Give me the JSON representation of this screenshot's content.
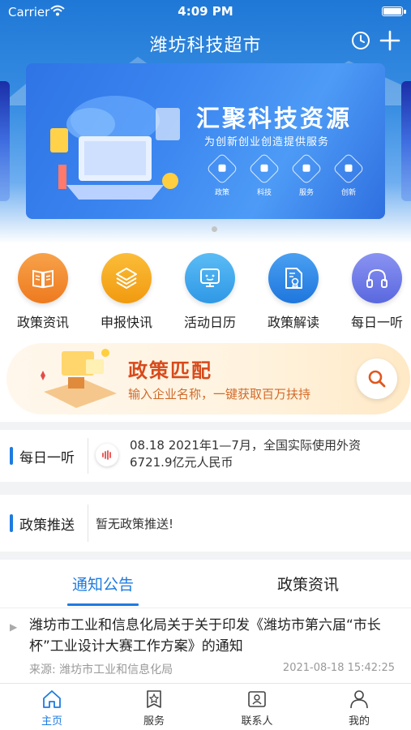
{
  "status_bar": {
    "carrier": "Carrier",
    "time": "4:09 PM"
  },
  "header": {
    "title": "潍坊科技超市"
  },
  "banner": {
    "heading": "汇聚科技资源",
    "subheading": "为创新创业创造提供服务",
    "tags": [
      "政策",
      "科技",
      "服务",
      "创新"
    ]
  },
  "quick_entries": [
    {
      "label": "政策资讯",
      "icon": "book-icon",
      "color": "#f08a2c"
    },
    {
      "label": "申报快讯",
      "icon": "layers-icon",
      "color": "#f4a21d"
    },
    {
      "label": "活动日历",
      "icon": "calendar-screen-icon",
      "color": "#3aa7ee"
    },
    {
      "label": "政策解读",
      "icon": "document-award-icon",
      "color": "#2d86e6"
    },
    {
      "label": "每日一听",
      "icon": "headphones-icon",
      "color": "#6678e8"
    }
  ],
  "policy_match": {
    "title": "政策匹配",
    "description": "输入企业名称，一键获取百万扶持"
  },
  "daily_listen": {
    "label": "每日一听",
    "text": "08.18 2021年1—7月，全国实际使用外资6721.9亿元人民币"
  },
  "policy_push": {
    "label": "政策推送",
    "text": "暂无政策推送!"
  },
  "tabs": [
    {
      "label": "通知公告",
      "active": true
    },
    {
      "label": "政策资讯",
      "active": false
    }
  ],
  "notices": [
    {
      "title": "潍坊市工业和信息化局关于关于印发《潍坊市第六届“市长杯”工业设计大赛工作方案》的通知",
      "source": "来源: 潍坊市工业和信息化局",
      "date": "2021-08-18 15:42:25"
    }
  ],
  "bottom_nav": [
    {
      "label": "主页",
      "icon": "home-icon",
      "active": true
    },
    {
      "label": "服务",
      "icon": "service-star-icon",
      "active": false
    },
    {
      "label": "联系人",
      "icon": "contact-card-icon",
      "active": false
    },
    {
      "label": "我的",
      "icon": "person-icon",
      "active": false
    }
  ],
  "colors": {
    "accent": "#1e7be0",
    "match_title": "#d84a1b"
  }
}
